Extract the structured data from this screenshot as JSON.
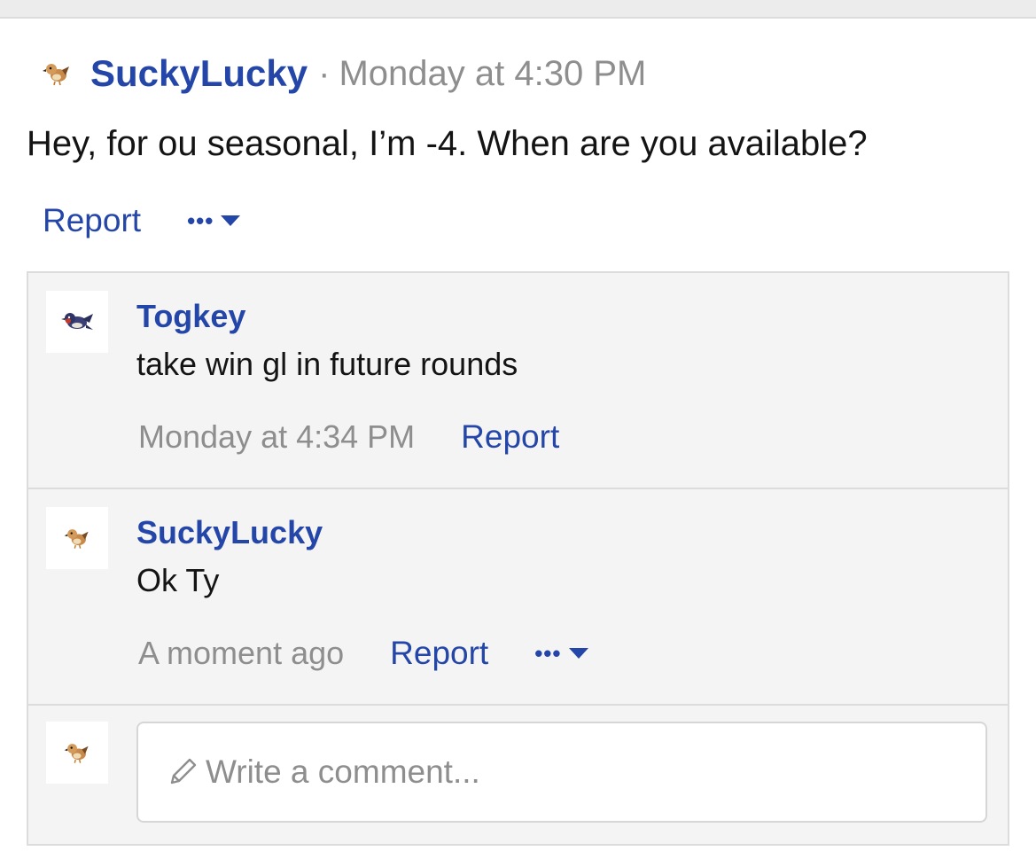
{
  "post": {
    "author": "SuckyLucky",
    "separator": "·",
    "time": "Monday at 4:30 PM",
    "body": "Hey, for ou seasonal, I’m -4. When are you available?",
    "report_label": "Report",
    "more_label": "•••"
  },
  "comments": [
    {
      "author": "Togkey",
      "text": "take win gl in future rounds",
      "time": "Monday at 4:34 PM",
      "report_label": "Report"
    },
    {
      "author": "SuckyLucky",
      "text": "Ok Ty",
      "time": "A moment ago",
      "report_label": "Report",
      "more_label": "•••"
    }
  ],
  "comment_box": {
    "placeholder": "Write a comment..."
  },
  "colors": {
    "link": "#2446a8",
    "muted": "#8e8e8e",
    "panel": "#f4f4f4",
    "border": "#dcdcdc"
  },
  "icons": {
    "author_avatar": "pidgey-sprite-icon",
    "togkey_avatar": "taillow-sprite-icon",
    "more": "ellipsis-icon",
    "caret": "caret-down-icon",
    "comment_pencil": "pencil-icon"
  }
}
